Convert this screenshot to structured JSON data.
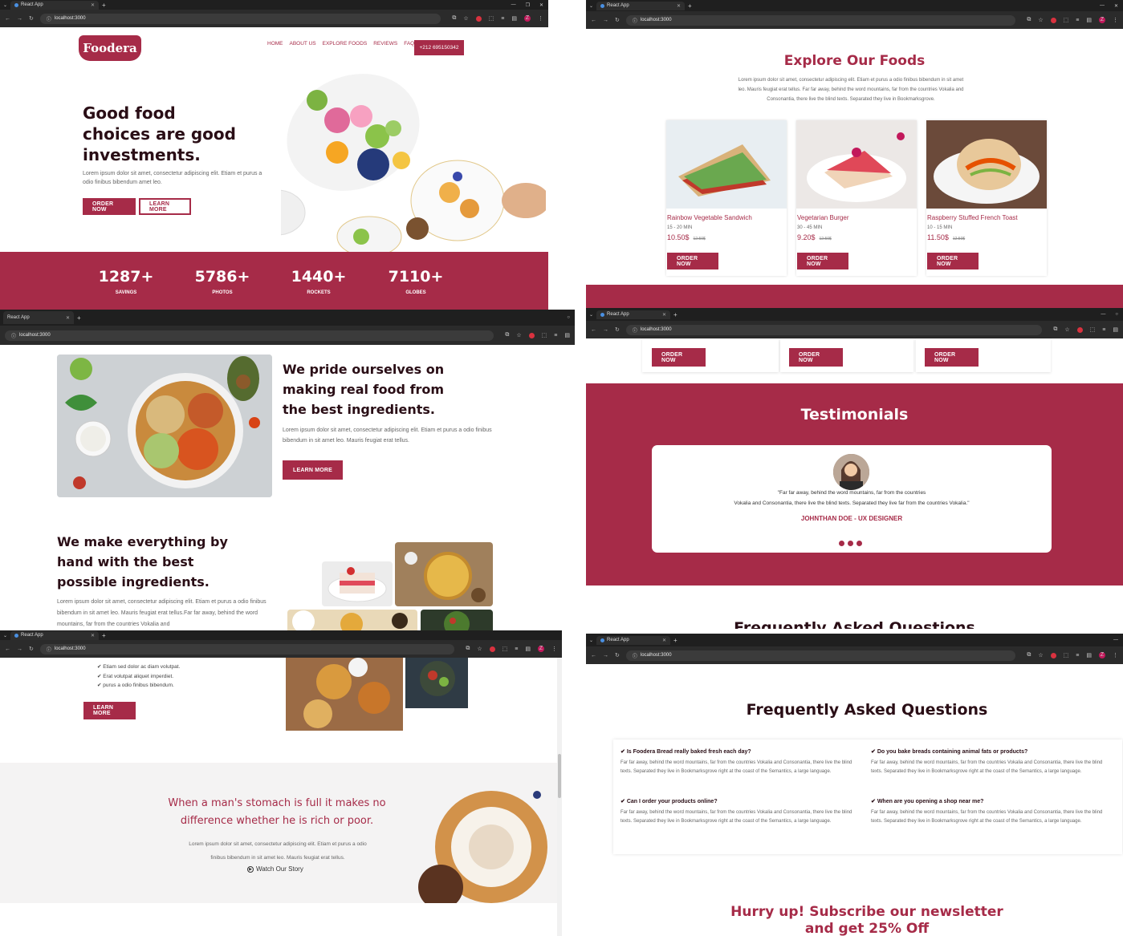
{
  "browser": {
    "tab_title": "React App",
    "url": "localhost:3000",
    "new_tab": "+",
    "profile_initial": "Z"
  },
  "brand": {
    "logo_text": "Foodera",
    "primary_color": "#a62b48"
  },
  "nav": {
    "items": [
      "HOME",
      "ABOUT US",
      "EXPLORE FOODS",
      "REVIEWS",
      "FAQ"
    ],
    "phone": "+212 695150342"
  },
  "hero": {
    "title_lines": [
      "Good food",
      "choices are good",
      "investments."
    ],
    "text": "Lorem ipsum dolor sit amet, consectetur adipiscing elit. Etiam et purus a odio finibus bibendum amet leo.",
    "order_button": "ORDER NOW",
    "learn_button": "LEARN MORE"
  },
  "stats": [
    {
      "value": "1287+",
      "label": "SAVINGS"
    },
    {
      "value": "5786+",
      "label": "PHOTOS"
    },
    {
      "value": "1440+",
      "label": "ROCKETS"
    },
    {
      "value": "7110+",
      "label": "GLOBES"
    }
  ],
  "pride": {
    "title_lines": [
      "We pride ourselves on",
      "making real food from",
      "the best ingredients."
    ],
    "text": "Lorem ipsum dolor sit amet, consectetur adipiscing elit. Etiam et purus a odio finibus bibendum in sit amet leo. Mauris feugiat erat tellus.",
    "button": "LEARN MORE"
  },
  "hand": {
    "title_lines": [
      "We make everything by",
      "hand with the best",
      "possible ingredients."
    ],
    "text": "Lorem ipsum dolor sit amet, consectetur adipiscing elit. Etiam et purus a odio finibus bibendum in sit amet leo. Mauris feugiat erat tellus.Far far away, behind the word mountains, far from the countries Vokalia and",
    "checklist": [
      "Etiam sed dolor ac diam volutpat.",
      "Erat volutpat aliquet imperdiet.",
      "purus a odio finibus bibendum."
    ],
    "button": "LEARN MORE"
  },
  "quote": {
    "title_lines": [
      "When a man's stomach is full it makes no",
      "difference whether he is rich or poor."
    ],
    "text_lines": [
      "Lorem ipsum dolor sit amet, consectetur adipiscing elit. Etiam et purus a odio",
      "finibus bibendum in sit amet leo. Mauris feugiat erat tellus."
    ],
    "watch_label": "Watch Our Story"
  },
  "explore": {
    "title": "Explore Our Foods",
    "text_lines": [
      "Lorem ipsum dolor sit amet, consectetur adipiscing elit. Etiam et purus a odio finibus bibendum in sit amet",
      "leo. Mauris feugiat erat tellus. Far far away, behind the word mountains, far from the countries Vokalia and",
      "Consonantia, there live the blind texts. Separated they live in Bookmarksgrove."
    ],
    "foods": [
      {
        "name": "Rainbow Vegetable Sandwich",
        "time": "15 - 20 MIN",
        "price": "10.50$",
        "old_price": "12.50$",
        "button": "ORDER NOW"
      },
      {
        "name": "Vegetarian Burger",
        "time": "30 - 45 MIN",
        "price": "9.20$",
        "old_price": "12.50$",
        "button": "ORDER NOW"
      },
      {
        "name": "Raspberry Stuffed French Toast",
        "time": "10 - 15 MIN",
        "price": "11.50$",
        "old_price": "12.50$",
        "button": "ORDER NOW"
      }
    ]
  },
  "testimonials": {
    "title": "Testimonials",
    "quote_lines": [
      "\"Far far away, behind the word mountains, far from the countries",
      "Vokalia and Consonantia, there live the blind texts. Separated they live far from the countries Vokalia.\""
    ],
    "author": "JOHNTHAN DOE - UX DESIGNER",
    "peek_title": "Frequently Asked Questions"
  },
  "faq": {
    "title": "Frequently Asked Questions",
    "items": [
      {
        "q": "Is Foodera Bread really baked fresh each day?",
        "a": "Far far away, behind the word mountains, far from the countries Vokalia and Consonantia, there live the blind texts. Separated they live in Bookmarksgrove right at the coast of the Semantics, a large language."
      },
      {
        "q": "Do you bake breads containing animal fats or products?",
        "a": "Far far away, behind the word mountains, far from the countries Vokalia and Consonantia, there live the blind texts. Separated they live in Bookmarksgrove right at the coast of the Semantics, a large language."
      },
      {
        "q": "Can I order your products online?",
        "a": "Far far away, behind the word mountains, far from the countries Vokalia and Consonantia, there live the blind texts. Separated they live in Bookmarksgrove right at the coast of the Semantics, a large language."
      },
      {
        "q": "When are you opening a shop near me?",
        "a": "Far far away, behind the word mountains, far from the countries Vokalia and Consonantia, there live the blind texts. Separated they live in Bookmarksgrove right at the coast of the Semantics, a large language."
      }
    ]
  },
  "newsletter": {
    "title_lines": [
      "Hurry up! Subscribe our newsletter",
      "and get 25% Off"
    ]
  }
}
